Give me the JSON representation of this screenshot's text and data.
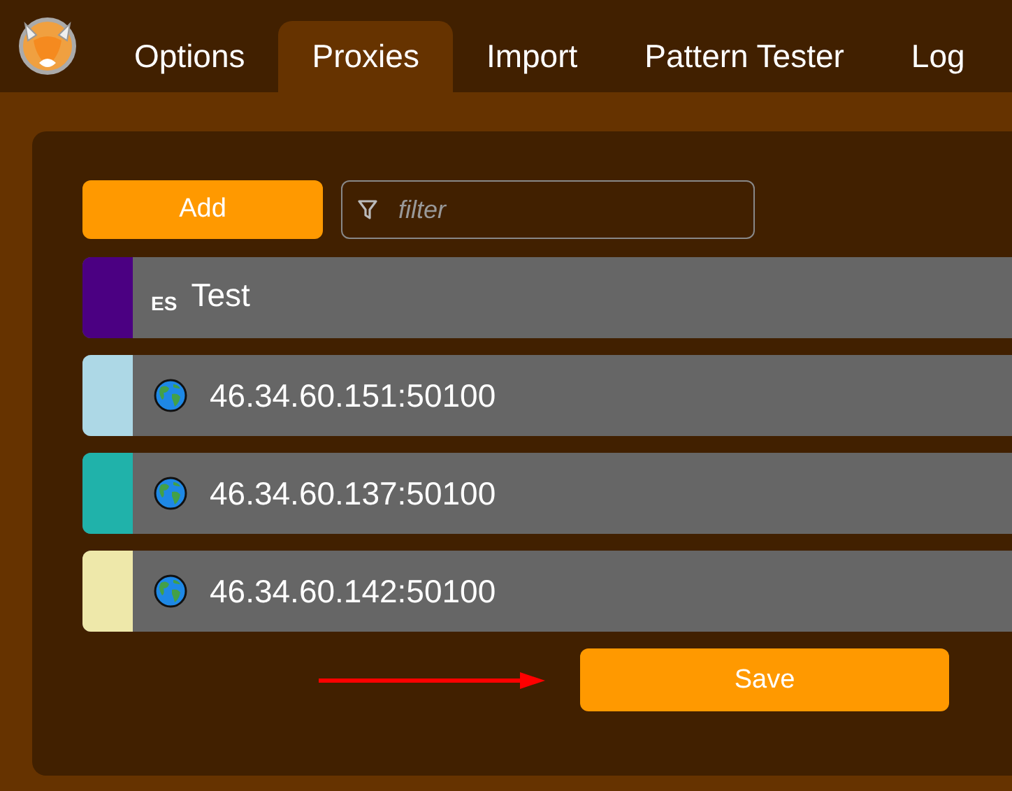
{
  "tabs": [
    {
      "label": "Options",
      "selected": false
    },
    {
      "label": "Proxies",
      "selected": true
    },
    {
      "label": "Import",
      "selected": false
    },
    {
      "label": "Pattern Tester",
      "selected": false
    },
    {
      "label": "Log",
      "selected": false
    }
  ],
  "add_button": "Add",
  "filter": {
    "placeholder": "filter"
  },
  "proxies": [
    {
      "kind": "pattern",
      "badge": "ES",
      "title": "Test",
      "color": "#4b0082"
    },
    {
      "kind": "proxy",
      "title": "46.34.60.151:50100",
      "color": "#add8e6"
    },
    {
      "kind": "proxy",
      "title": "46.34.60.137:50100",
      "color": "#20b2aa"
    },
    {
      "kind": "proxy",
      "title": "46.34.60.142:50100",
      "color": "#eee8aa"
    }
  ],
  "save_button": "Save"
}
